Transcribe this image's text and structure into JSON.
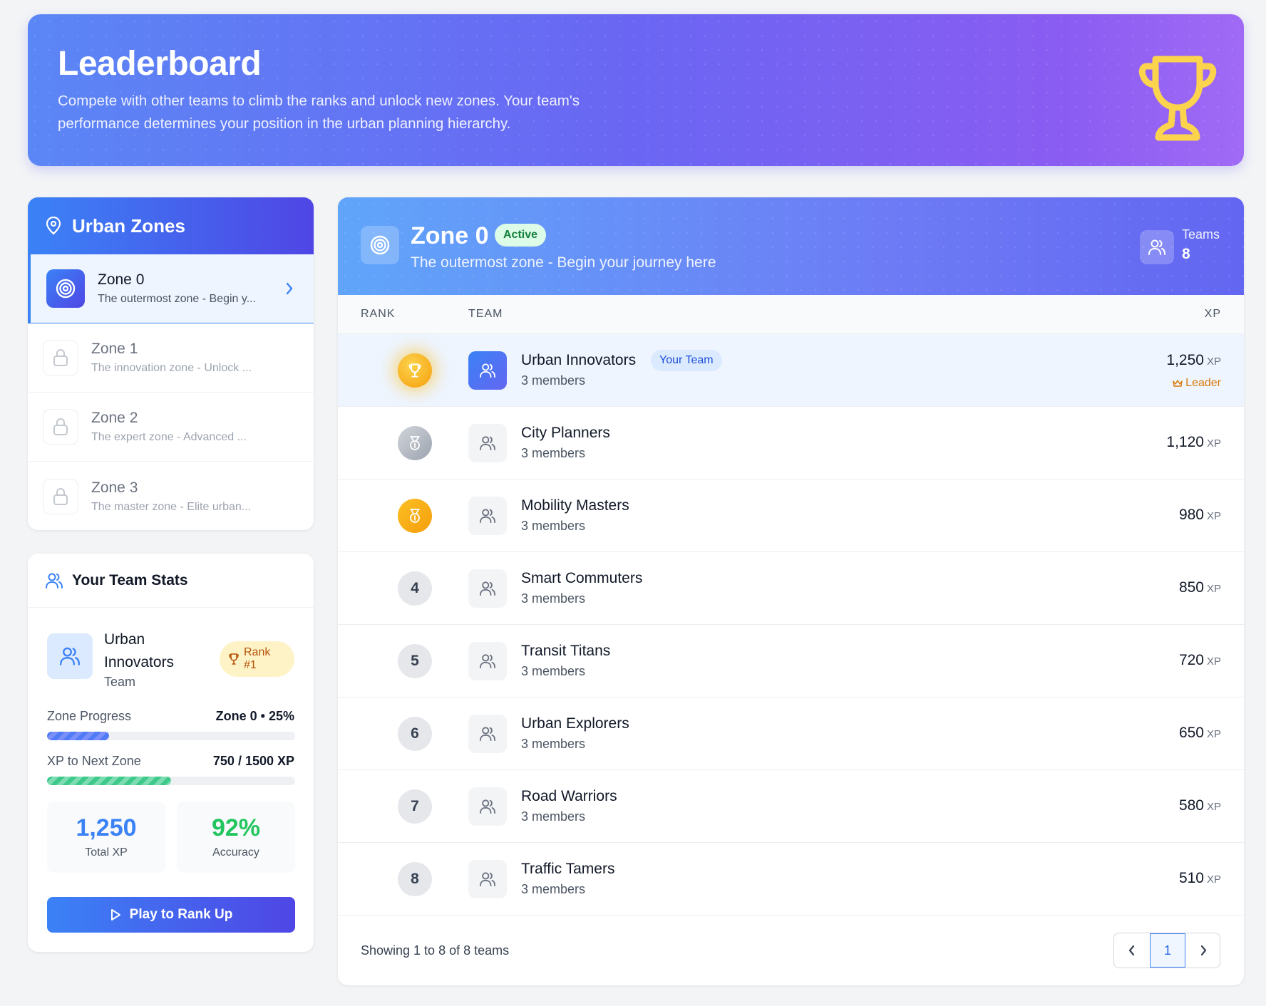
{
  "hero": {
    "title": "Leaderboard",
    "description": "Compete with other teams to climb the ranks and unlock new zones. Your team's performance determines your position in the urban planning hierarchy.",
    "icon": "trophy-icon"
  },
  "sidebar": {
    "title": "Urban Zones",
    "zones": [
      {
        "name": "Zone 0",
        "desc": "The outermost zone - Begin y...",
        "state": "active"
      },
      {
        "name": "Zone 1",
        "desc": "The innovation zone - Unlock ...",
        "state": "locked"
      },
      {
        "name": "Zone 2",
        "desc": "The expert zone - Advanced ...",
        "state": "locked"
      },
      {
        "name": "Zone 3",
        "desc": "The master zone - Elite urban...",
        "state": "locked"
      }
    ]
  },
  "stats": {
    "title": "Your Team Stats",
    "team_name": "Urban Innovators",
    "team_label": "Team",
    "rank_label": "Rank #1",
    "zone_progress_label": "Zone Progress",
    "zone_progress_value": "Zone 0 • 25%",
    "zone_progress_fraction": 0.25,
    "xp_label": "XP to Next Zone",
    "xp_value": "750 / 1500 XP",
    "xp_fraction": 0.5,
    "total_xp": "1,250",
    "total_xp_label": "Total XP",
    "accuracy": "92%",
    "accuracy_label": "Accuracy",
    "play_button": "Play to Rank Up"
  },
  "zone_header": {
    "title": "Zone 0",
    "badge": "Active",
    "desc": "The outermost zone - Begin your journey here",
    "teams_label": "Teams",
    "teams_count": "8"
  },
  "table": {
    "headers": {
      "rank": "RANK",
      "team": "TEAM",
      "xp": "XP"
    },
    "your_team_label": "Your Team",
    "leader_label": "Leader",
    "xp_unit": "XP",
    "rows": [
      {
        "rank": "1",
        "name": "Urban Innovators",
        "members": "3 members",
        "xp": "1,250"
      },
      {
        "rank": "2",
        "name": "City Planners",
        "members": "3 members",
        "xp": "1,120"
      },
      {
        "rank": "3",
        "name": "Mobility Masters",
        "members": "3 members",
        "xp": "980"
      },
      {
        "rank": "4",
        "name": "Smart Commuters",
        "members": "3 members",
        "xp": "850"
      },
      {
        "rank": "5",
        "name": "Transit Titans",
        "members": "3 members",
        "xp": "720"
      },
      {
        "rank": "6",
        "name": "Urban Explorers",
        "members": "3 members",
        "xp": "650"
      },
      {
        "rank": "7",
        "name": "Road Warriors",
        "members": "3 members",
        "xp": "580"
      },
      {
        "rank": "8",
        "name": "Traffic Tamers",
        "members": "3 members",
        "xp": "510"
      }
    ]
  },
  "footer": {
    "showing": "Showing 1 to 8 of 8 teams",
    "page": "1"
  },
  "colors": {
    "accent": "#3b82f6",
    "indigo": "#4f46e5",
    "gold": "#f59e0b",
    "success": "#22c55e"
  }
}
